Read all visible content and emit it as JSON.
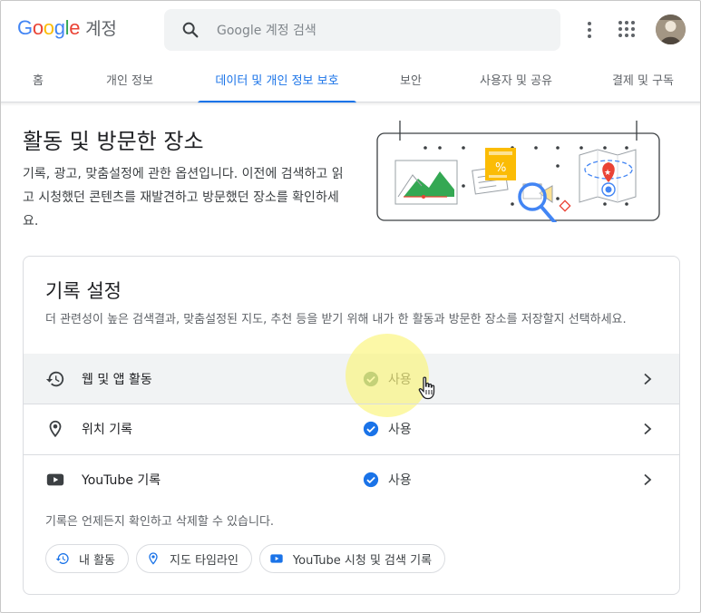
{
  "header": {
    "logo_letters": [
      "G",
      "o",
      "o",
      "g",
      "l",
      "e"
    ],
    "account_label": "계정",
    "search_placeholder": "Google 계정 검색",
    "icons": {
      "search": "search-icon",
      "more": "more-vert-icon",
      "apps": "apps-grid-icon",
      "avatar": "avatar"
    }
  },
  "tabs": [
    {
      "label": "홈",
      "active": false
    },
    {
      "label": "개인 정보",
      "active": false
    },
    {
      "label": "데이터 및 개인 정보 보호",
      "active": true
    },
    {
      "label": "보안",
      "active": false
    },
    {
      "label": "사용자 및 공유",
      "active": false
    },
    {
      "label": "결제 및 구독",
      "active": false
    }
  ],
  "intro": {
    "title": "활동 및 방문한 장소",
    "description": "기록, 광고, 맞춤설정에 관한 옵션입니다. 이전에 검색하고 읽고 시청했던 콘텐츠를 재발견하고 방문했던 장소를 확인하세요."
  },
  "history": {
    "title": "기록 설정",
    "description": "더 관련성이 높은 검색결과, 맞춤설정된 지도, 추천 등을 받기 위해 내가 한 활동과 방문한 장소를 저장할지 선택하세요.",
    "rows": [
      {
        "icon": "history-icon",
        "label": "웹 및 앱 활동",
        "status": "사용",
        "highlighted": true
      },
      {
        "icon": "location-pin-icon",
        "label": "위치 기록",
        "status": "사용",
        "highlighted": false
      },
      {
        "icon": "youtube-icon",
        "label": "YouTube 기록",
        "status": "사용",
        "highlighted": false
      }
    ],
    "note": "기록은 언제든지 확인하고 삭제할 수 있습니다.",
    "chips": [
      {
        "icon": "history-icon",
        "label": "내 활동"
      },
      {
        "icon": "location-pin-icon",
        "label": "지도 타임라인"
      },
      {
        "icon": "youtube-icon",
        "label": "YouTube 시청 및 검색 기록"
      }
    ]
  },
  "colors": {
    "accent": "#1a73e8",
    "check_active": "#1a73e8",
    "check_hover": "#5f8f7a",
    "highlight_glow": "#faf578",
    "text_primary": "#202124",
    "text_secondary": "#5f6368"
  }
}
